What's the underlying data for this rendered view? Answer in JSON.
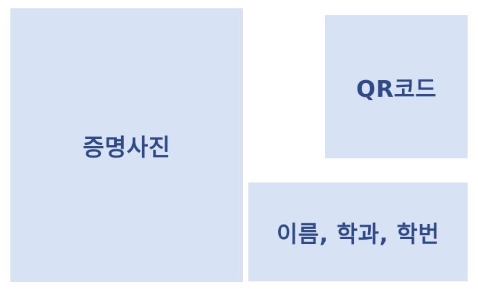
{
  "layout": {
    "photo_box": {
      "label": "증명사진"
    },
    "qr_box": {
      "label": "QR코드"
    },
    "info_box": {
      "label": "이름, 학과, 학번"
    }
  },
  "colors": {
    "box_fill": "#d7e2f4",
    "label_text": "#2f4a87",
    "background": "#ffffff"
  }
}
